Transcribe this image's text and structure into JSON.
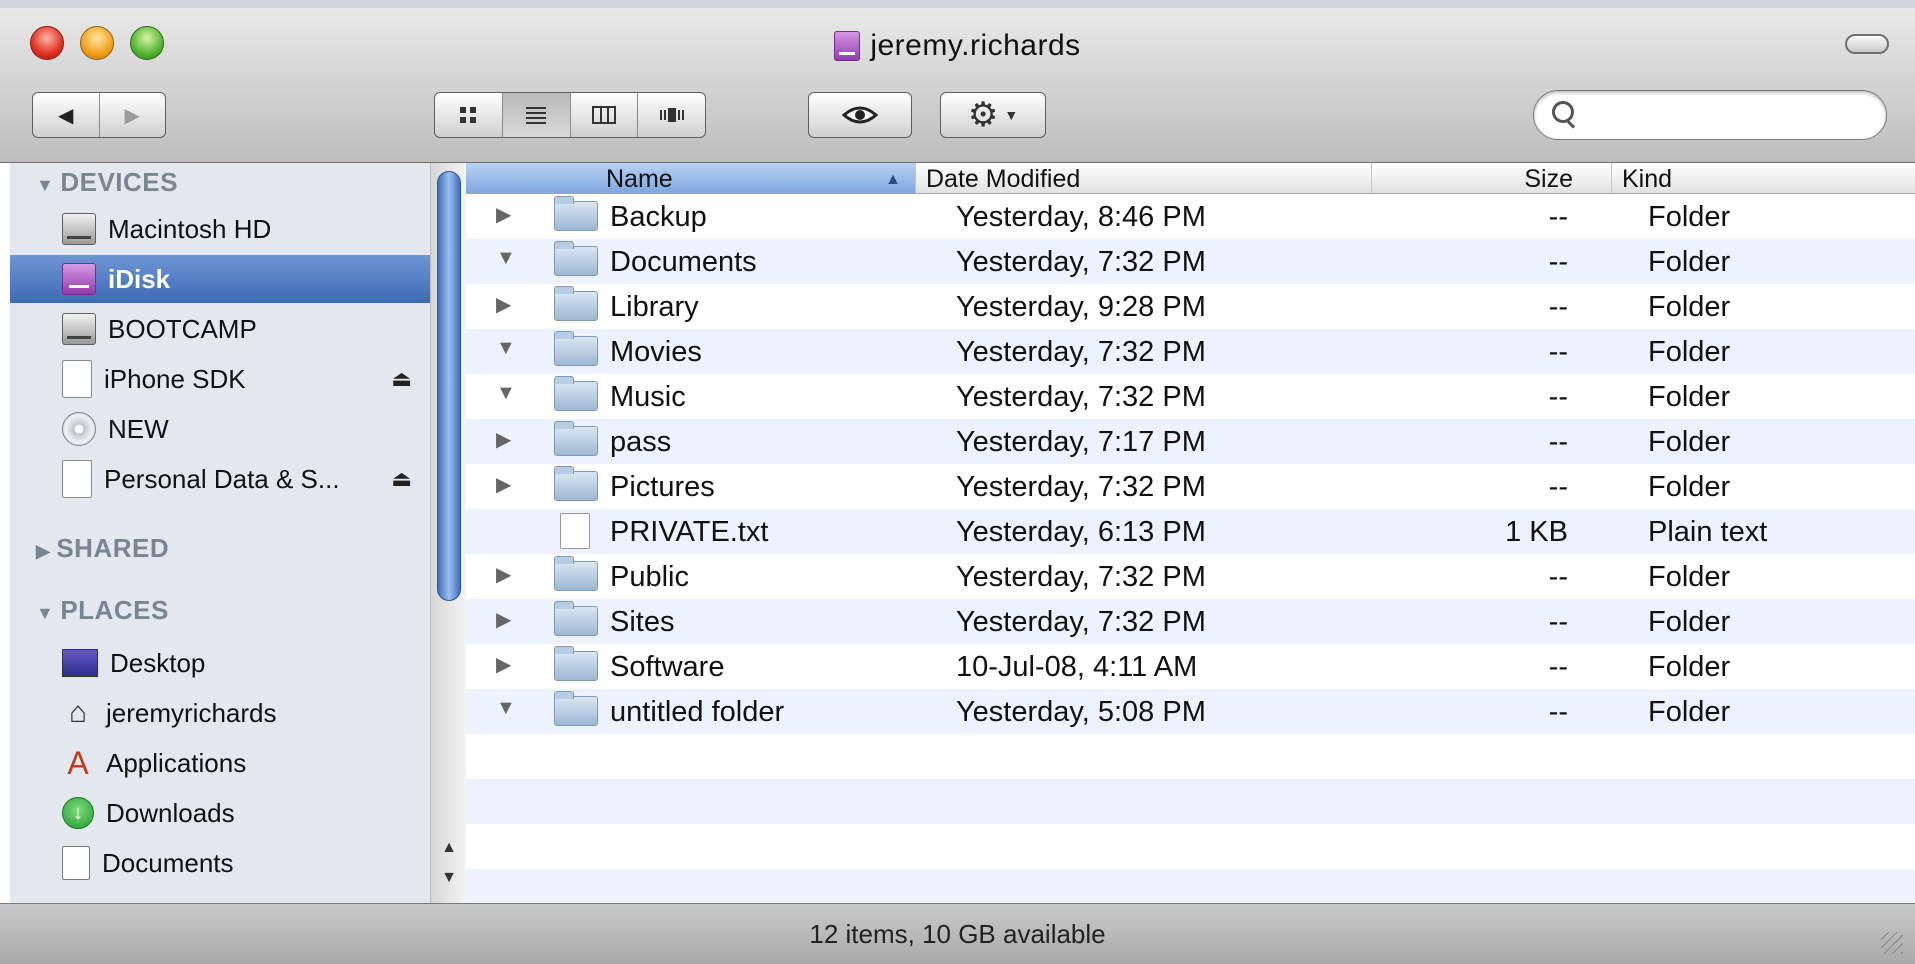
{
  "window": {
    "title": "jeremy.richards",
    "title_icon": "idisk-icon"
  },
  "toolbar": {
    "back_glyph": "◀",
    "forward_glyph": "▶",
    "view_modes": [
      "icon-view",
      "list-view",
      "column-view",
      "cover-flow-view"
    ],
    "active_view": "list-view",
    "quick_look_glyph": "👁",
    "action_glyph": "⚙",
    "search": {
      "value": "",
      "placeholder": ""
    }
  },
  "sidebar": {
    "devices_label": "DEVICES",
    "shared_label": "SHARED",
    "places_label": "PLACES",
    "devices": [
      {
        "label": "Macintosh HD",
        "icon": "hard-drive-icon"
      },
      {
        "label": "iDisk",
        "icon": "idisk-icon",
        "selected": true
      },
      {
        "label": "BOOTCAMP",
        "icon": "hard-drive-icon"
      },
      {
        "label": "iPhone SDK",
        "icon": "disk-image-icon",
        "eject": true
      },
      {
        "label": "NEW",
        "icon": "cd-icon"
      },
      {
        "label": "Personal Data & S...",
        "icon": "disk-image-icon",
        "eject": true
      }
    ],
    "places": [
      {
        "label": "Desktop",
        "icon": "desktop-icon"
      },
      {
        "label": "jeremyrichards",
        "icon": "home-icon"
      },
      {
        "label": "Applications",
        "icon": "applications-icon"
      },
      {
        "label": "Downloads",
        "icon": "downloads-icon"
      },
      {
        "label": "Documents",
        "icon": "documents-icon"
      }
    ]
  },
  "list": {
    "columns": {
      "name": "Name",
      "date": "Date Modified",
      "size": "Size",
      "kind": "Kind"
    },
    "rows": [
      {
        "name": "Backup",
        "date": "Yesterday, 8:46 PM",
        "size": "--",
        "kind": "Folder",
        "disclosure": "▶"
      },
      {
        "name": "Documents",
        "date": "Yesterday, 7:32 PM",
        "size": "--",
        "kind": "Folder",
        "disclosure": "▼"
      },
      {
        "name": "Library",
        "date": "Yesterday, 9:28 PM",
        "size": "--",
        "kind": "Folder",
        "disclosure": "▶"
      },
      {
        "name": "Movies",
        "date": "Yesterday, 7:32 PM",
        "size": "--",
        "kind": "Folder",
        "disclosure": "▼"
      },
      {
        "name": "Music",
        "date": "Yesterday, 7:32 PM",
        "size": "--",
        "kind": "Folder",
        "disclosure": "▼"
      },
      {
        "name": "pass",
        "date": "Yesterday, 7:17 PM",
        "size": "--",
        "kind": "Folder",
        "disclosure": "▶"
      },
      {
        "name": "Pictures",
        "date": "Yesterday, 7:32 PM",
        "size": "--",
        "kind": "Folder",
        "disclosure": "▶"
      },
      {
        "name": "PRIVATE.txt",
        "date": "Yesterday, 6:13 PM",
        "size": "1 KB",
        "kind": "Plain text",
        "disclosure": ""
      },
      {
        "name": "Public",
        "date": "Yesterday, 7:32 PM",
        "size": "--",
        "kind": "Folder",
        "disclosure": "▶"
      },
      {
        "name": "Sites",
        "date": "Yesterday, 7:32 PM",
        "size": "--",
        "kind": "Folder",
        "disclosure": "▶"
      },
      {
        "name": "Software",
        "date": "10-Jul-08, 4:11 AM",
        "size": "--",
        "kind": "Folder",
        "disclosure": "▶"
      },
      {
        "name": "untitled folder",
        "date": "Yesterday, 5:08 PM",
        "size": "--",
        "kind": "Folder",
        "disclosure": "▼"
      }
    ]
  },
  "status": {
    "text": "12 items, 10 GB available"
  },
  "colors": {
    "selection": "#4f79c1",
    "sidebar_bg": "#e3e8ef",
    "alt_row": "#edf3fe"
  }
}
